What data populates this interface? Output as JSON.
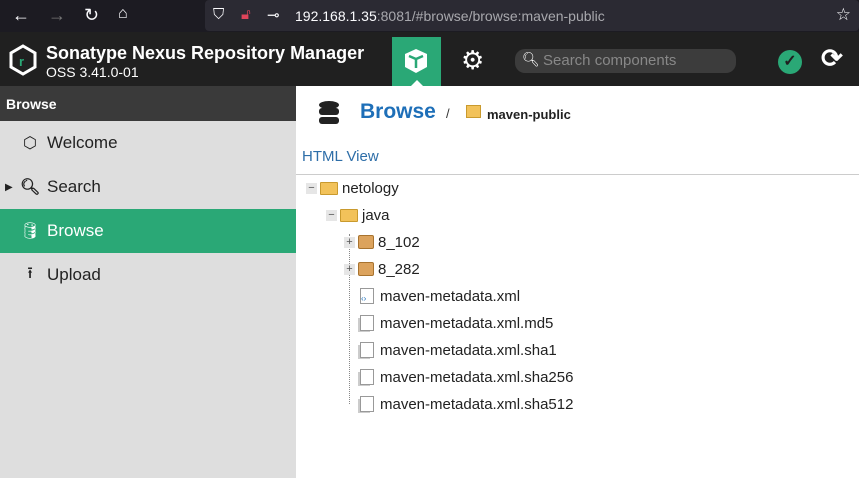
{
  "browser": {
    "url_host": "192.168.1.35",
    "url_rest": ":8081/#browse/browse:maven-public"
  },
  "header": {
    "title": "Sonatype Nexus Repository Manager",
    "version": "OSS 3.41.0-01",
    "search_placeholder": "Search components",
    "accent": "#2aa876"
  },
  "sidebar": {
    "title": "Browse",
    "items": [
      {
        "label": "Welcome",
        "icon": "hexagon-icon"
      },
      {
        "label": "Search",
        "icon": "search-icon"
      },
      {
        "label": "Browse",
        "icon": "database-icon",
        "selected": true
      },
      {
        "label": "Upload",
        "icon": "upload-icon"
      }
    ]
  },
  "main": {
    "title": "Browse",
    "separator": "/",
    "repository": "maven-public",
    "html_view": "HTML View",
    "tree": [
      {
        "label": "netology",
        "type": "folder",
        "level": 0,
        "expanded": true
      },
      {
        "label": "java",
        "type": "folder",
        "level": 1,
        "expanded": true
      },
      {
        "label": "8_102",
        "type": "component",
        "level": 2
      },
      {
        "label": "8_282",
        "type": "component",
        "level": 2
      },
      {
        "label": "maven-metadata.xml",
        "type": "xml",
        "level": 2
      },
      {
        "label": "maven-metadata.xml.md5",
        "type": "file",
        "level": 2
      },
      {
        "label": "maven-metadata.xml.sha1",
        "type": "file",
        "level": 2
      },
      {
        "label": "maven-metadata.xml.sha256",
        "type": "file",
        "level": 2
      },
      {
        "label": "maven-metadata.xml.sha512",
        "type": "file",
        "level": 2
      }
    ]
  }
}
